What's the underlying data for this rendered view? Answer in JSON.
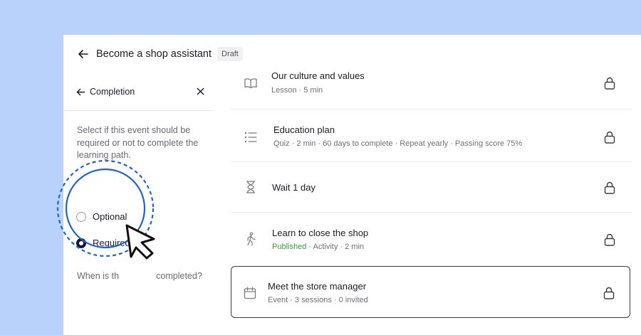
{
  "header": {
    "back_icon": "arrow-left-icon",
    "title": "Become a shop assistant",
    "badge": "Draft"
  },
  "panel": {
    "back_icon": "arrow-left-icon",
    "title": "Completion",
    "close_icon": "close-icon",
    "description": "Select if this event should be required or not to complete the learning path.",
    "options": [
      {
        "label": "Optional",
        "selected": false
      },
      {
        "label": "Required",
        "selected": true
      }
    ],
    "when_label": "When is th               completed?"
  },
  "items": [
    {
      "icon": "book-icon",
      "title": "Our culture and values",
      "meta": "Lesson · 5 min",
      "status": "",
      "lock": "lock-icon"
    },
    {
      "icon": "list-icon",
      "title": "Education plan",
      "meta": "Quiz · 2 min · 60 days to complete · Repeat yearly · Passing score 75%",
      "status": "",
      "lock": "lock-icon"
    },
    {
      "icon": "hourglass-icon",
      "title": "Wait 1 day",
      "meta": "",
      "status": "",
      "lock": "lock-icon"
    },
    {
      "icon": "walking-person-icon",
      "title": "Learn to close the shop",
      "meta": " · Activity · 2 min",
      "status": "Published",
      "lock": "lock-icon"
    },
    {
      "icon": "calendar-icon",
      "title": "Meet the store manager",
      "meta": "Event · 3 sessions · 0 invited",
      "status": "",
      "lock": "lock-icon"
    }
  ],
  "colors": {
    "background": "#b8d2fb",
    "highlight_ring": "#1d63c9",
    "published": "#3c9a3c",
    "radio_selected": "#141436"
  }
}
